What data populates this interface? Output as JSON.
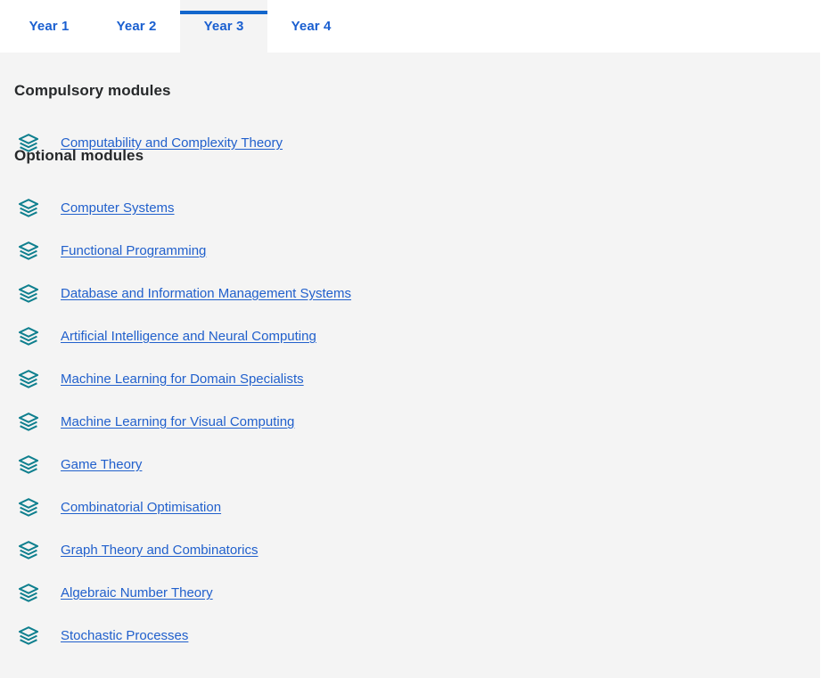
{
  "tabs": [
    {
      "label": "Year 1",
      "active": false
    },
    {
      "label": "Year 2",
      "active": false
    },
    {
      "label": "Year 3",
      "active": true
    },
    {
      "label": "Year 4",
      "active": false
    }
  ],
  "sections": [
    {
      "heading": "Compulsory modules",
      "icon": "layers-icon",
      "modules": [
        "Computability and Complexity Theory"
      ]
    },
    {
      "heading": "Optional modules",
      "icon": "layers-icon",
      "modules": [
        "Computer Systems",
        "Functional Programming",
        "Database and Information Management Systems",
        "Artificial Intelligence and Neural Computing",
        "Machine Learning for Domain Specialists",
        "Machine Learning for Visual Computing",
        "Game Theory",
        "Combinatorial Optimisation",
        "Graph Theory and Combinatorics",
        "Algebraic Number Theory",
        "Stochastic Processes"
      ]
    }
  ],
  "colors": {
    "tab_text": "#1a5fd0",
    "active_tab_indicator": "#1266cc",
    "active_tab_background": "#f4f4f4",
    "panel_background": "#f4f4f4",
    "heading_text": "#26282a",
    "link_text": "#2160cc",
    "icon_teal": "#0e7f8e"
  }
}
